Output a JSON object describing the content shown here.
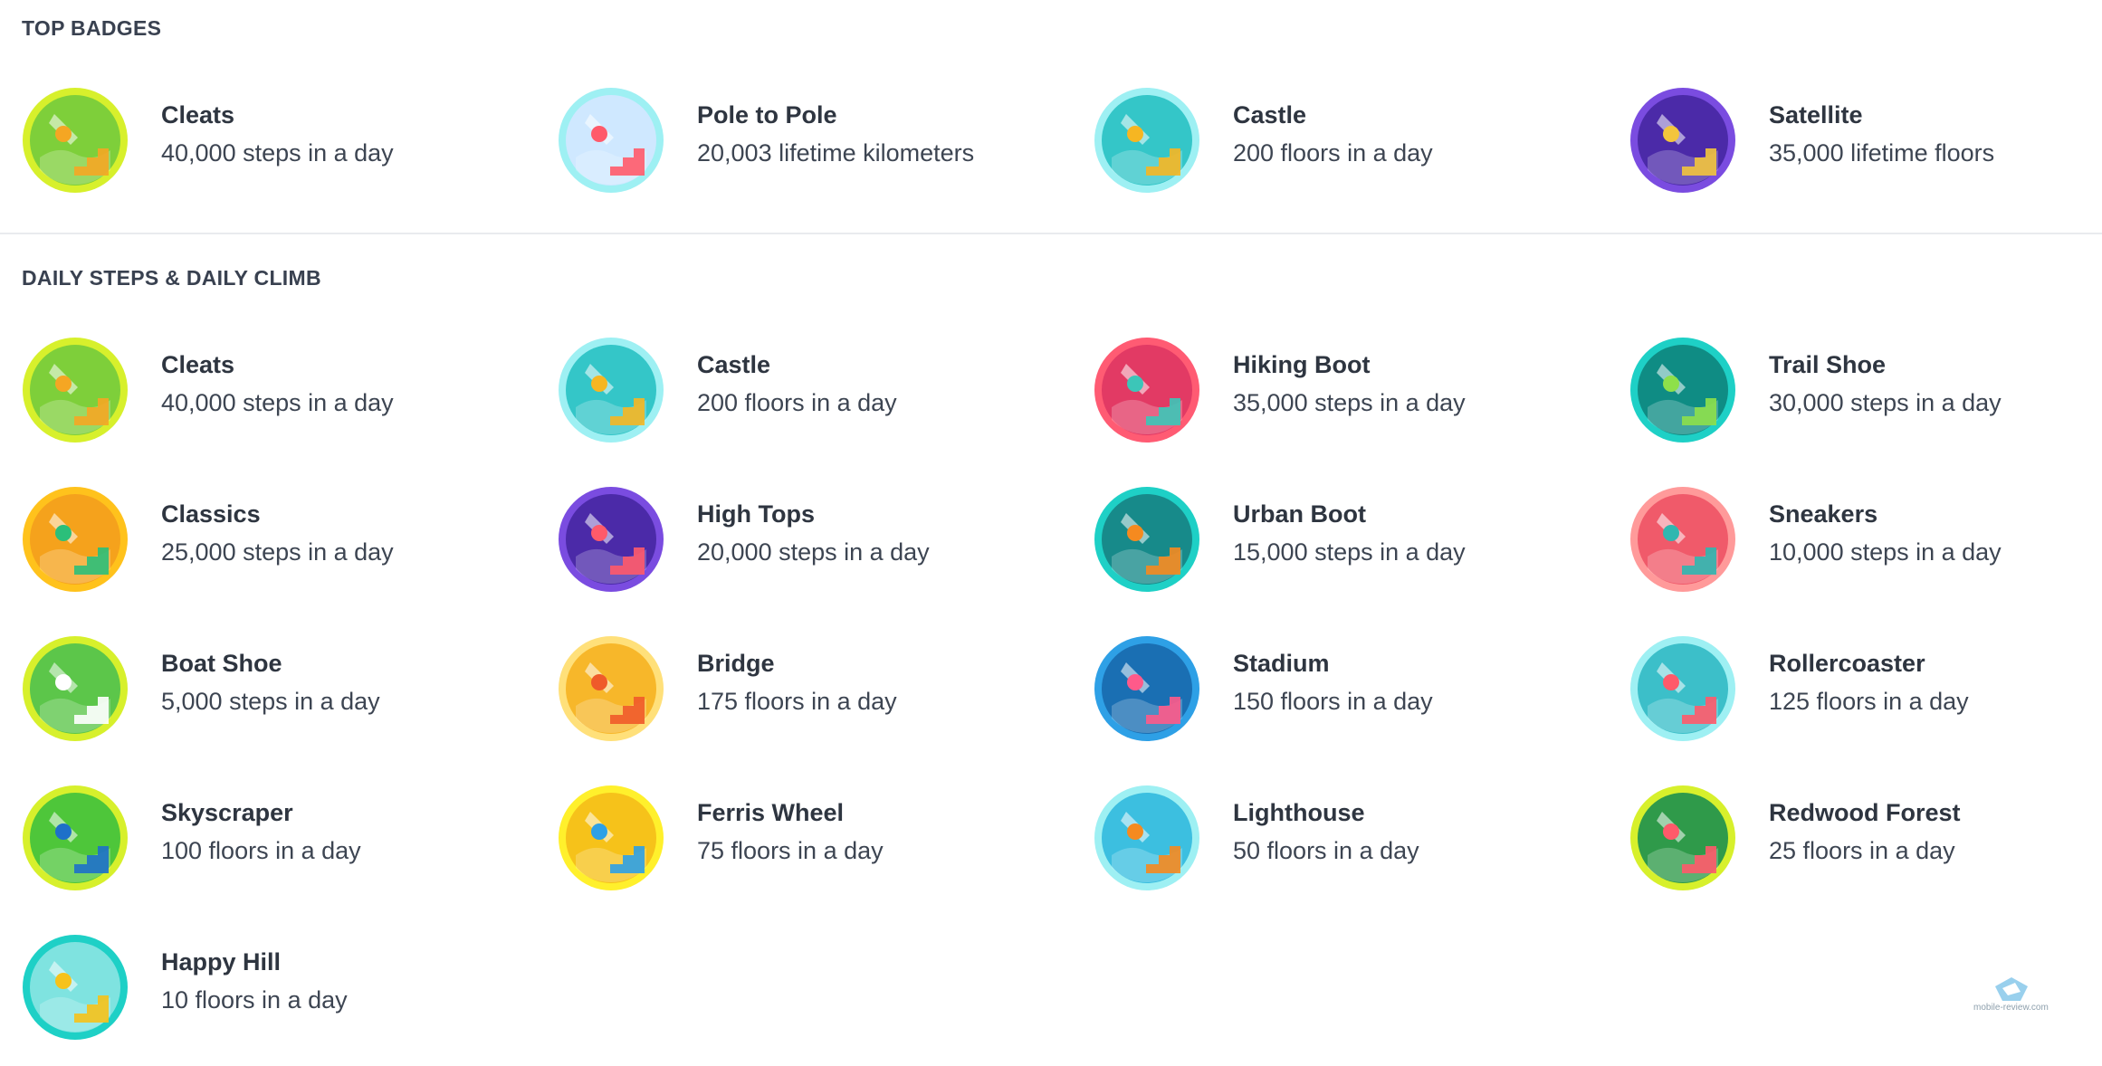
{
  "sections": [
    {
      "title": "TOP BADGES"
    },
    {
      "title": "DAILY STEPS & DAILY CLIMB"
    }
  ],
  "top_badges": [
    {
      "name": "Cleats",
      "desc": "40,000 steps in a day",
      "icon": "cleats-icon",
      "ring": "#d7f02c",
      "bg": "#7ecf3a",
      "accent": "#f5a623"
    },
    {
      "name": "Pole to Pole",
      "desc": "20,003 lifetime kilometers",
      "icon": "pole-icon",
      "ring": "#9ef0f3",
      "bg": "#cfe8ff",
      "accent": "#ff5a6a"
    },
    {
      "name": "Castle",
      "desc": "200 floors in a day",
      "icon": "castle-icon",
      "ring": "#9ef0f3",
      "bg": "#34c6c8",
      "accent": "#f6b622"
    },
    {
      "name": "Satellite",
      "desc": "35,000 lifetime floors",
      "icon": "satellite-icon",
      "ring": "#7a4ce0",
      "bg": "#4b2aa8",
      "accent": "#f3c53d"
    }
  ],
  "daily_badges": [
    {
      "name": "Cleats",
      "desc": "40,000 steps in a day",
      "icon": "cleats-icon",
      "ring": "#d7f02c",
      "bg": "#7ecf3a",
      "accent": "#f5a623"
    },
    {
      "name": "Castle",
      "desc": "200 floors in a day",
      "icon": "castle-icon",
      "ring": "#9ef0f3",
      "bg": "#34c6c8",
      "accent": "#f6b622"
    },
    {
      "name": "Hiking Boot",
      "desc": "35,000 steps in a day",
      "icon": "hiking-boot-icon",
      "ring": "#ff5b73",
      "bg": "#e23a64",
      "accent": "#3cc6b8"
    },
    {
      "name": "Trail Shoe",
      "desc": "30,000 steps in a day",
      "icon": "trail-shoe-icon",
      "ring": "#1ed0c6",
      "bg": "#0f8c84",
      "accent": "#8ee04a"
    },
    {
      "name": "Classics",
      "desc": "25,000 steps in a day",
      "icon": "classics-icon",
      "ring": "#ffc21c",
      "bg": "#f5a21c",
      "accent": "#2bbf7a"
    },
    {
      "name": "High Tops",
      "desc": "20,000 steps in a day",
      "icon": "high-tops-icon",
      "ring": "#7a4ce0",
      "bg": "#4b2aa8",
      "accent": "#ff5a6a"
    },
    {
      "name": "Urban Boot",
      "desc": "15,000 steps in a day",
      "icon": "urban-boot-icon",
      "ring": "#1ed0c6",
      "bg": "#178a8a",
      "accent": "#f58a1f"
    },
    {
      "name": "Sneakers",
      "desc": "10,000 steps in a day",
      "icon": "sneakers-icon",
      "ring": "#ff9a9a",
      "bg": "#f05a6a",
      "accent": "#2fb7b0"
    },
    {
      "name": "Boat Shoe",
      "desc": "5,000 steps in a day",
      "icon": "boat-shoe-icon",
      "ring": "#d7f02c",
      "bg": "#5cc64a",
      "accent": "#ffffff"
    },
    {
      "name": "Bridge",
      "desc": "175 floors in a day",
      "icon": "bridge-icon",
      "ring": "#ffe07a",
      "bg": "#f7b72a",
      "accent": "#ef5a2a"
    },
    {
      "name": "Stadium",
      "desc": "150 floors in a day",
      "icon": "stadium-icon",
      "ring": "#2ea0e6",
      "bg": "#1a6fb3",
      "accent": "#ff5a8a"
    },
    {
      "name": "Rollercoaster",
      "desc": "125 floors in a day",
      "icon": "rollercoaster-icon",
      "ring": "#9ef0f3",
      "bg": "#3cbfc9",
      "accent": "#ff5a6a"
    },
    {
      "name": "Skyscraper",
      "desc": "100 floors in a day",
      "icon": "skyscraper-icon",
      "ring": "#d7f02c",
      "bg": "#4ec63a",
      "accent": "#1e70c9"
    },
    {
      "name": "Ferris Wheel",
      "desc": "75 floors in a day",
      "icon": "ferris-wheel-icon",
      "ring": "#fff02c",
      "bg": "#f6c21a",
      "accent": "#2ea0e6"
    },
    {
      "name": "Lighthouse",
      "desc": "50 floors in a day",
      "icon": "lighthouse-icon",
      "ring": "#9ef0f3",
      "bg": "#3cbfe0",
      "accent": "#f58a1f"
    },
    {
      "name": "Redwood Forest",
      "desc": "25 floors in a day",
      "icon": "redwood-forest-icon",
      "ring": "#d7f02c",
      "bg": "#2f9a4a",
      "accent": "#ff5a6a"
    },
    {
      "name": "Happy Hill",
      "desc": "10 floors in a day",
      "icon": "happy-hill-icon",
      "ring": "#1ed0c6",
      "bg": "#7fe3e0",
      "accent": "#f6c21a"
    }
  ],
  "watermark": {
    "text": "mobile-review.com"
  }
}
